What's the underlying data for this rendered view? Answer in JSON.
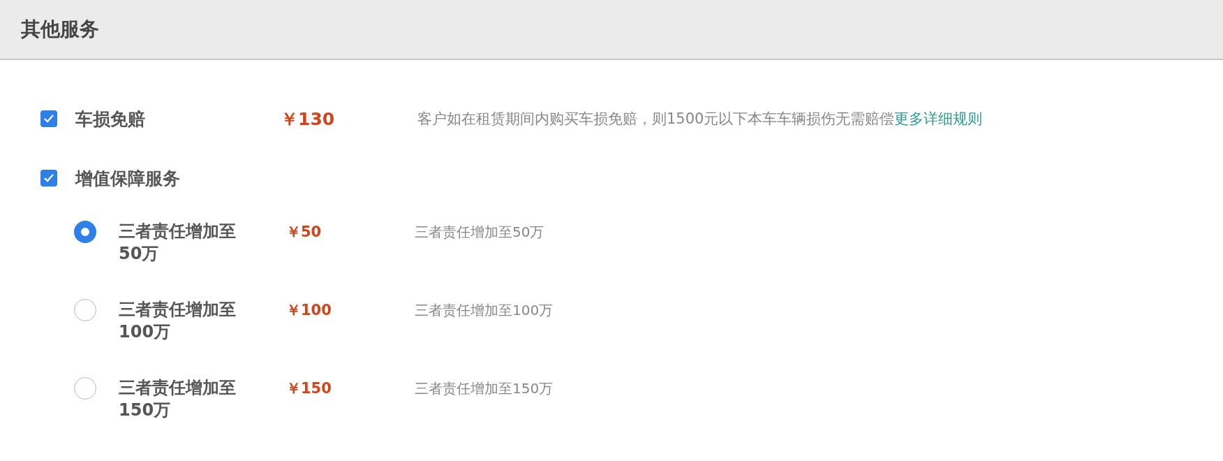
{
  "header": {
    "title": "其他服务"
  },
  "services": [
    {
      "kind": "checkbox",
      "checked": true,
      "name": "车损免赔",
      "price": "￥130",
      "description": "客户如在租赁期间内购买车损免赔，则1500元以下本车车辆损伤无需赔偿",
      "link": "更多详细规则"
    },
    {
      "kind": "checkbox",
      "checked": true,
      "name": "增值保障服务",
      "options": [
        {
          "selected": true,
          "name": "三者责任增加至50万",
          "price": "￥50",
          "description": "三者责任增加至50万"
        },
        {
          "selected": false,
          "name": "三者责任增加至100万",
          "price": "￥100",
          "description": "三者责任增加至100万"
        },
        {
          "selected": false,
          "name": "三者责任增加至150万",
          "price": "￥150",
          "description": "三者责任增加至150万"
        }
      ]
    }
  ]
}
